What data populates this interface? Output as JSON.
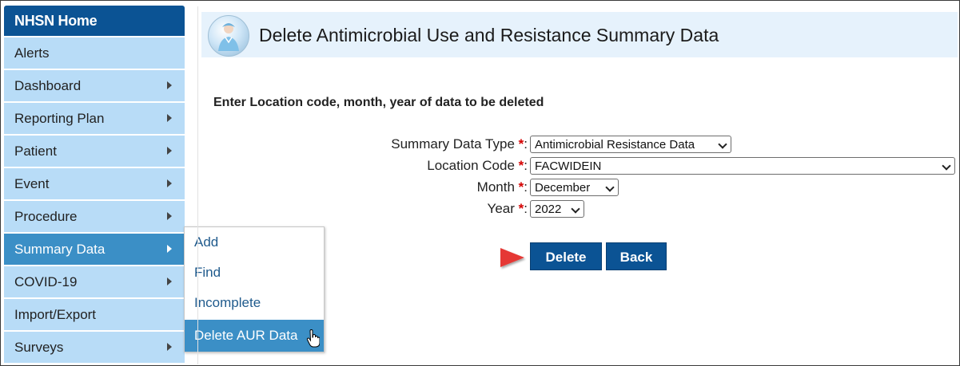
{
  "sidebar": {
    "home": "NHSN Home",
    "items": [
      {
        "label": "Alerts",
        "arrow": false,
        "active": false
      },
      {
        "label": "Dashboard",
        "arrow": true,
        "active": false
      },
      {
        "label": "Reporting Plan",
        "arrow": true,
        "active": false
      },
      {
        "label": "Patient",
        "arrow": true,
        "active": false
      },
      {
        "label": "Event",
        "arrow": true,
        "active": false
      },
      {
        "label": "Procedure",
        "arrow": true,
        "active": false
      },
      {
        "label": "Summary Data",
        "arrow": true,
        "active": true
      },
      {
        "label": "COVID-19",
        "arrow": true,
        "active": false
      },
      {
        "label": "Import/Export",
        "arrow": false,
        "active": false
      },
      {
        "label": "Surveys",
        "arrow": true,
        "active": false
      }
    ]
  },
  "flyout": {
    "items": [
      "Add",
      "Find",
      "Incomplete",
      "Delete AUR Data"
    ]
  },
  "header": {
    "title": "Delete Antimicrobial Use and Resistance Summary Data"
  },
  "form": {
    "instruction": "Enter Location code, month, year of data to be deleted",
    "required_mark": "*",
    "fields": [
      {
        "label": "Summary Data Type",
        "value": "Antimicrobial Resistance Data"
      },
      {
        "label": "Location Code",
        "value": "FACWIDEIN"
      },
      {
        "label": "Month",
        "value": "December"
      },
      {
        "label": "Year",
        "value": "2022"
      }
    ]
  },
  "buttons": {
    "delete": "Delete",
    "back": "Back"
  },
  "colors": {
    "primary": "#0b5394",
    "sidebar_bg": "#b8dcf7",
    "active_bg": "#3b8fc6",
    "header_bg": "#e6f2fc",
    "required": "#d40000",
    "annotation_arrow": "#e53935"
  }
}
